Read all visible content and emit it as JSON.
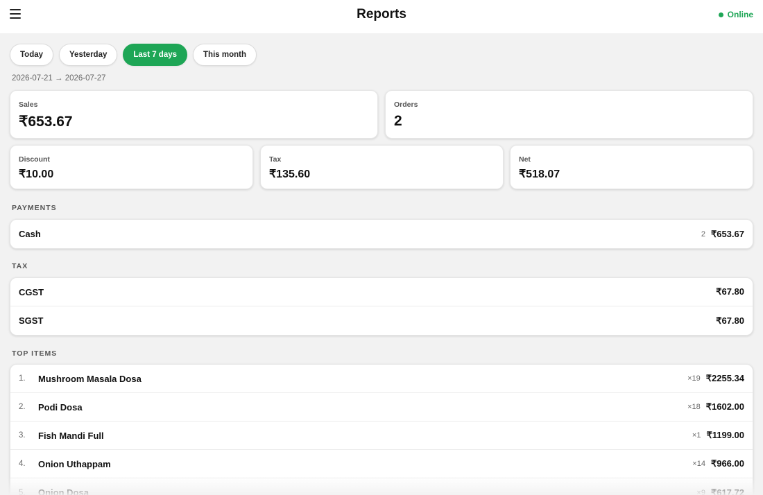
{
  "header": {
    "title": "Reports",
    "status": "Online"
  },
  "filters": [
    "Today",
    "Yesterday",
    "Last 7 days",
    "This month"
  ],
  "active_filter": "Last 7 days",
  "date_range": "2026-07-21 → 2026-07-27",
  "summary": {
    "sales": {
      "label": "Sales",
      "value": "₹653.67"
    },
    "orders": {
      "label": "Orders",
      "value": "2"
    },
    "discount": {
      "label": "Discount",
      "value": "₹10.00"
    },
    "tax": {
      "label": "Tax",
      "value": "₹135.60"
    },
    "net": {
      "label": "Net",
      "value": "₹518.07"
    }
  },
  "payments": {
    "title": "PAYMENTS",
    "rows": [
      {
        "name": "Cash",
        "count": "2",
        "amount": "₹653.67"
      }
    ]
  },
  "tax_breakdown": {
    "title": "TAX",
    "rows": [
      {
        "name": "CGST",
        "amount": "₹67.80"
      },
      {
        "name": "SGST",
        "amount": "₹67.80"
      }
    ]
  },
  "top_items": {
    "title": "TOP ITEMS",
    "rows": [
      {
        "rank": "1.",
        "name": "Mushroom Masala Dosa",
        "qty": "×19",
        "amount": "₹2255.34"
      },
      {
        "rank": "2.",
        "name": "Podi Dosa",
        "qty": "×18",
        "amount": "₹1602.00"
      },
      {
        "rank": "3.",
        "name": "Fish Mandi Full",
        "qty": "×1",
        "amount": "₹1199.00"
      },
      {
        "rank": "4.",
        "name": "Onion Uthappam",
        "qty": "×14",
        "amount": "₹966.00"
      },
      {
        "rank": "5.",
        "name": "Onion Dosa",
        "qty": "×9",
        "amount": "₹617.72"
      }
    ]
  }
}
